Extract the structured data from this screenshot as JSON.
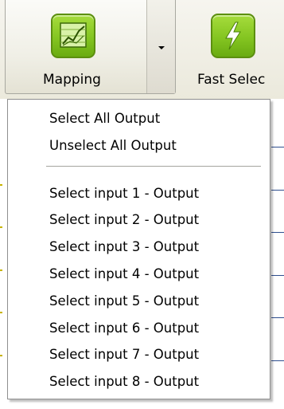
{
  "toolbar": {
    "mapping": {
      "label": "Mapping",
      "icon": "line-chart-icon",
      "icon_color": "#84c521"
    },
    "fast_select": {
      "label": "Fast Selec",
      "icon": "lightning-bolt-icon",
      "icon_color": "#84c521"
    }
  },
  "menu": {
    "group1": [
      "Select All Output",
      "Unselect All Output"
    ],
    "group2": [
      "Select input 1 - Output",
      "Select input 2 - Output",
      "Select input 3 - Output",
      "Select input 4 - Output",
      "Select input 5 - Output",
      "Select input 6 - Output",
      "Select input 7 - Output",
      "Select input 8 - Output"
    ]
  }
}
